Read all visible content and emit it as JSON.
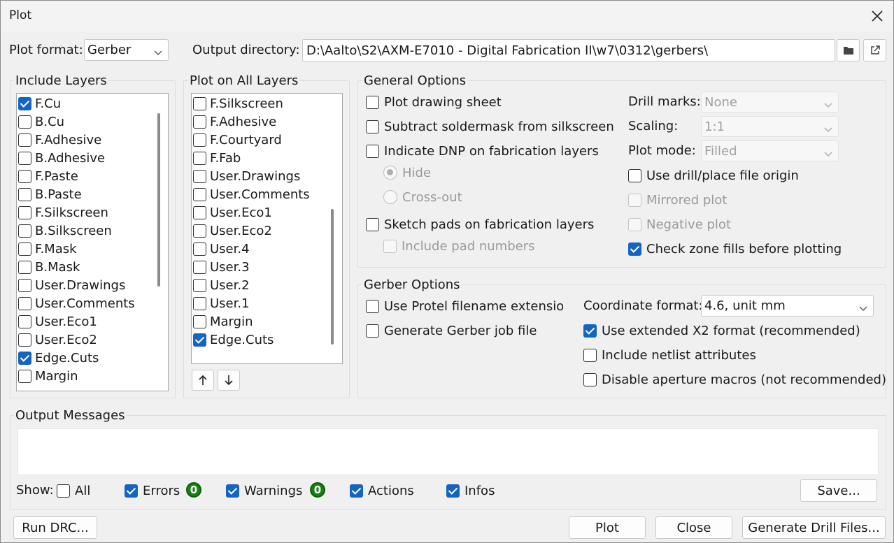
{
  "window": {
    "title": "Plot"
  },
  "top": {
    "plot_format_label": "Plot format:",
    "plot_format_value": "Gerber",
    "output_dir_label": "Output directory:",
    "output_dir_value": "D:\\Aalto\\S2\\AXM-E7010 - Digital Fabrication II\\w7\\0312\\gerbers\\"
  },
  "include_layers": {
    "title": "Include Layers",
    "items": [
      {
        "label": "F.Cu",
        "checked": true
      },
      {
        "label": "B.Cu",
        "checked": false
      },
      {
        "label": "F.Adhesive",
        "checked": false
      },
      {
        "label": "B.Adhesive",
        "checked": false
      },
      {
        "label": "F.Paste",
        "checked": false
      },
      {
        "label": "B.Paste",
        "checked": false
      },
      {
        "label": "F.Silkscreen",
        "checked": false
      },
      {
        "label": "B.Silkscreen",
        "checked": false
      },
      {
        "label": "F.Mask",
        "checked": false
      },
      {
        "label": "B.Mask",
        "checked": false
      },
      {
        "label": "User.Drawings",
        "checked": false
      },
      {
        "label": "User.Comments",
        "checked": false
      },
      {
        "label": "User.Eco1",
        "checked": false
      },
      {
        "label": "User.Eco2",
        "checked": false
      },
      {
        "label": "Edge.Cuts",
        "checked": true
      },
      {
        "label": "Margin",
        "checked": false
      }
    ]
  },
  "plot_all_layers": {
    "title": "Plot on All Layers",
    "items": [
      {
        "label": "F.Silkscreen",
        "checked": false
      },
      {
        "label": "F.Adhesive",
        "checked": false
      },
      {
        "label": "F.Courtyard",
        "checked": false
      },
      {
        "label": "F.Fab",
        "checked": false
      },
      {
        "label": "User.Drawings",
        "checked": false
      },
      {
        "label": "User.Comments",
        "checked": false
      },
      {
        "label": "User.Eco1",
        "checked": false
      },
      {
        "label": "User.Eco2",
        "checked": false
      },
      {
        "label": "User.4",
        "checked": false
      },
      {
        "label": "User.3",
        "checked": false
      },
      {
        "label": "User.2",
        "checked": false
      },
      {
        "label": "User.1",
        "checked": false
      },
      {
        "label": "Margin",
        "checked": false
      },
      {
        "label": "Edge.Cuts",
        "checked": true
      }
    ],
    "up_icon": "arrow-up-icon",
    "down_icon": "arrow-down-icon"
  },
  "general": {
    "title": "General Options",
    "plot_drawing_sheet": "Plot drawing sheet",
    "subtract_soldermask": "Subtract soldermask from silkscreen",
    "indicate_dnp": "Indicate DNP on fabrication layers",
    "hide": "Hide",
    "cross_out": "Cross-out",
    "sketch_pads": "Sketch pads on fabrication layers",
    "include_pad_numbers": "Include pad numbers",
    "drill_marks_label": "Drill marks:",
    "drill_marks_value": "None",
    "scaling_label": "Scaling:",
    "scaling_value": "1:1",
    "plot_mode_label": "Plot mode:",
    "plot_mode_value": "Filled",
    "use_drill_origin": "Use drill/place file origin",
    "mirrored_plot": "Mirrored plot",
    "negative_plot": "Negative plot",
    "check_zone_fills": "Check zone fills before plotting"
  },
  "gerber": {
    "title": "Gerber Options",
    "use_protel": "Use Protel filename extensions",
    "generate_job": "Generate Gerber job file",
    "coord_label": "Coordinate format:",
    "coord_value": "4.6, unit mm",
    "use_x2": "Use extended X2 format (recommended)",
    "netlist_attr": "Include netlist attributes",
    "disable_macros": "Disable aperture macros (not recommended)"
  },
  "messages": {
    "title": "Output Messages",
    "show_label": "Show:",
    "all": "All",
    "errors": "Errors",
    "errors_count": "0",
    "warnings": "Warnings",
    "warnings_count": "0",
    "actions": "Actions",
    "infos": "Infos",
    "save": "Save..."
  },
  "footer": {
    "run_drc": "Run DRC...",
    "plot": "Plot",
    "close": "Close",
    "gen_drill": "Generate Drill Files..."
  },
  "colors": {
    "accent": "#1565c0",
    "badge": "#1a7f12"
  }
}
